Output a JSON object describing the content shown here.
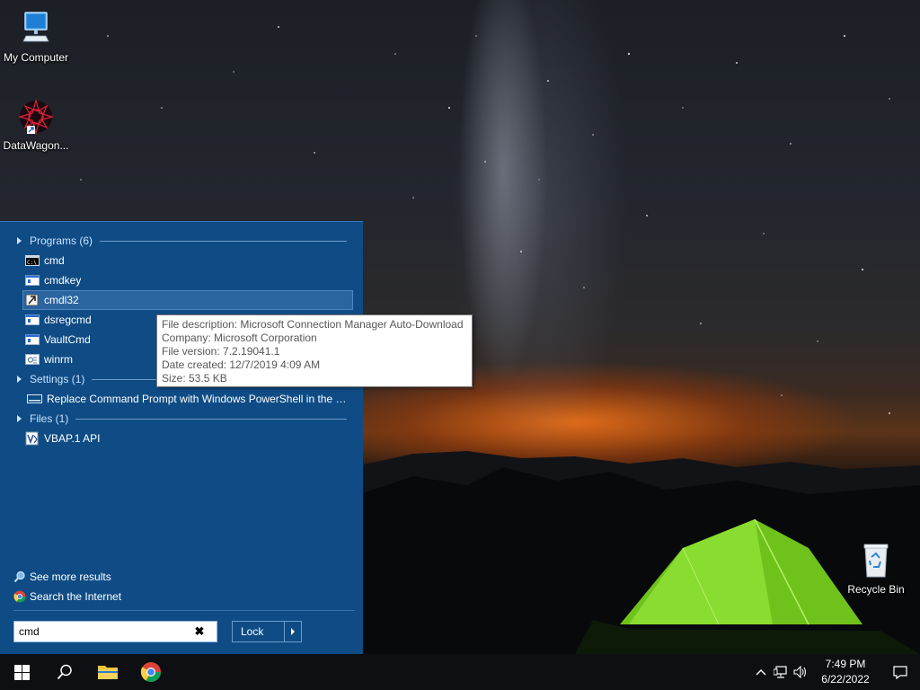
{
  "desktop": {
    "icons": [
      {
        "label": "My Computer"
      },
      {
        "label": "DataWagon..."
      },
      {
        "label": "Recycle Bin"
      }
    ]
  },
  "start": {
    "programs_header": "Programs (6)",
    "programs": [
      {
        "label": "cmd",
        "icon": "console-icon"
      },
      {
        "label": "cmdkey",
        "icon": "window-app-icon"
      },
      {
        "label": "cmdl32",
        "icon": "download-manager-icon"
      },
      {
        "label": "dsregcmd",
        "icon": "window-app-icon"
      },
      {
        "label": "VaultCmd",
        "icon": "window-app-icon"
      },
      {
        "label": "winrm",
        "icon": "script-icon"
      }
    ],
    "selected_program": "cmdl32",
    "settings_header": "Settings (1)",
    "settings": [
      {
        "label": "Replace Command Prompt with Windows PowerShell in the W...",
        "icon": "settings-panel-icon"
      }
    ],
    "files_header": "Files (1)",
    "files": [
      {
        "label": "VBAP.1 API",
        "icon": "vb-file-icon"
      }
    ],
    "see_more": "See more results",
    "search_internet": "Search the Internet",
    "search_value": "cmd",
    "power_button": "Lock"
  },
  "tooltip": {
    "lines": [
      "File description: Microsoft Connection Manager Auto-Download",
      "Company: Microsoft Corporation",
      "File version: 7.2.19041.1",
      "Date created: 12/7/2019 4:09 AM",
      "Size: 53.5 KB"
    ]
  },
  "taskbar": {
    "time": "7:49 PM",
    "date": "6/22/2022"
  },
  "colors": {
    "panel": "#0f4c85",
    "taskbar": "#0d0f12",
    "section_header": "#c8e1ff"
  }
}
